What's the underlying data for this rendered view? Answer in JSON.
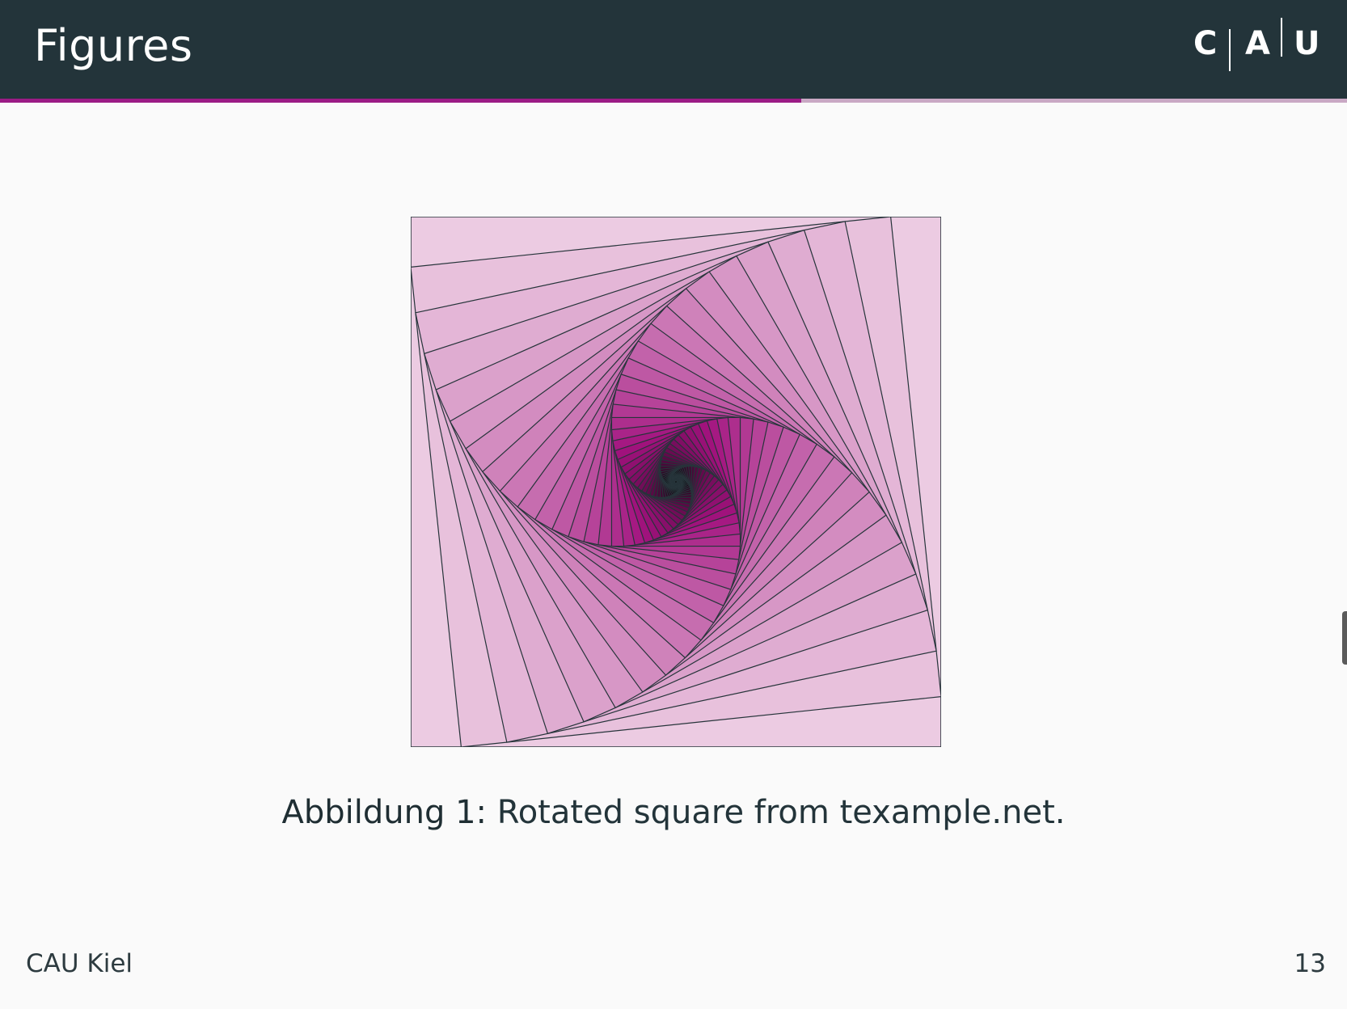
{
  "slide": {
    "title": "Figures",
    "progress": 0.595,
    "logo": {
      "letters": [
        "C",
        "A",
        "U"
      ]
    },
    "figure": {
      "description_icon": "rotated-square-spiral",
      "colors": {
        "outer_fill": "#eccbe2",
        "mid_fill": "#a2127e",
        "dark_fill": "#000000",
        "stroke": "#26343a"
      }
    },
    "caption": {
      "label": "Abbildung 1:",
      "text": " Rotated square from texample.net."
    },
    "footer": {
      "left": "CAU Kiel",
      "page_number": "13"
    },
    "theme": {
      "header_bg": "#23343a",
      "accent": "#9b1b85",
      "accent_light": "#c9a8c4",
      "background": "#fafafa"
    }
  }
}
